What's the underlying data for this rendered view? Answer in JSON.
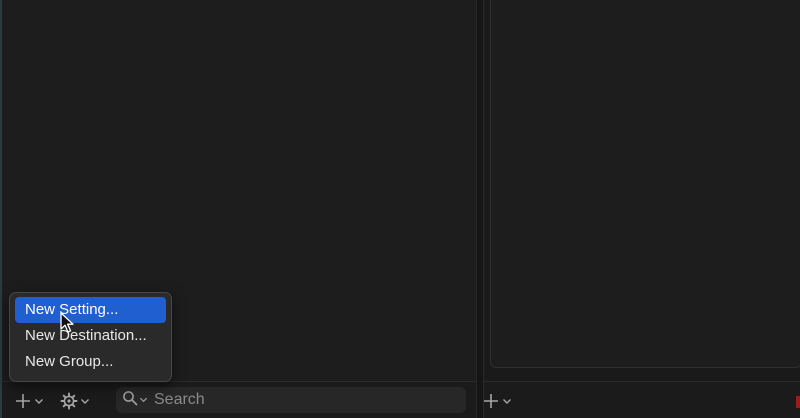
{
  "toolbar_left": {
    "add_button": {
      "icon": "plus-icon",
      "menu_indicator": "chevron-down-icon"
    },
    "settings_button": {
      "icon": "gear-icon",
      "menu_indicator": "chevron-down-icon"
    },
    "search": {
      "icon": "search-icon",
      "value": "",
      "placeholder": "Search"
    }
  },
  "toolbar_right": {
    "add_button": {
      "icon": "plus-icon",
      "menu_indicator": "chevron-down-icon"
    }
  },
  "add_menu": {
    "items": [
      {
        "label": "New Setting...",
        "highlighted": true
      },
      {
        "label": "New Destination...",
        "highlighted": false
      },
      {
        "label": "New Group...",
        "highlighted": false
      }
    ]
  },
  "colors": {
    "background": "#1b1b1b",
    "menu_background": "#2a2a2a",
    "menu_highlight": "#1f5fcf",
    "icon": "#a6a6a6"
  }
}
